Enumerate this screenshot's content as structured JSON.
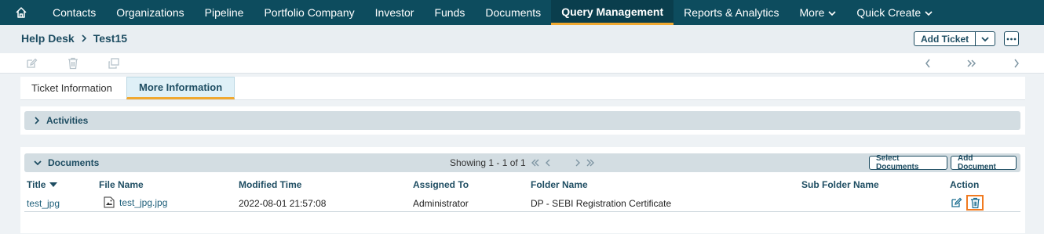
{
  "nav": {
    "home_icon": "home-icon",
    "items": [
      {
        "label": "Contacts"
      },
      {
        "label": "Organizations"
      },
      {
        "label": "Pipeline"
      },
      {
        "label": "Portfolio Company"
      },
      {
        "label": "Investor"
      },
      {
        "label": "Funds"
      },
      {
        "label": "Documents"
      },
      {
        "label": "Query Management",
        "active": true
      },
      {
        "label": "Reports & Analytics"
      },
      {
        "label": "More",
        "dropdown": true
      },
      {
        "label": "Quick Create",
        "dropdown": true
      }
    ]
  },
  "header": {
    "breadcrumb_root": "Help Desk",
    "breadcrumb_current": "Test15",
    "add_ticket_label": "Add Ticket"
  },
  "toolbar": {
    "icons": [
      "edit-icon",
      "trash-icon",
      "duplicate-icon"
    ],
    "nav_icons": [
      "chevron-left-icon",
      "double-chevron-right-icon",
      "chevron-right-icon"
    ]
  },
  "tabs": [
    {
      "label": "Ticket Information"
    },
    {
      "label": "More Information",
      "active": true
    }
  ],
  "activities": {
    "label": "Activities"
  },
  "documents": {
    "label": "Documents",
    "pager_text": "Showing 1 - 1 of 1",
    "select_button": "Select Documents",
    "add_button": "Add Document",
    "columns": {
      "title": "Title",
      "file_name": "File Name",
      "modified_time": "Modified Time",
      "assigned_to": "Assigned To",
      "folder_name": "Folder Name",
      "sub_folder_name": "Sub Folder Name",
      "action": "Action"
    },
    "rows": [
      {
        "title": "test_jpg",
        "file_name": "test_jpg.jpg",
        "modified_time": "2022-08-01 21:57:08",
        "assigned_to": "Administrator",
        "folder_name": "DP - SEBI Registration Certificate",
        "sub_folder_name": ""
      }
    ]
  },
  "colors": {
    "nav_bg": "#0d4c5e",
    "accent": "#f0a830",
    "text_dark": "#1e4d62",
    "highlight": "#f07a20"
  }
}
